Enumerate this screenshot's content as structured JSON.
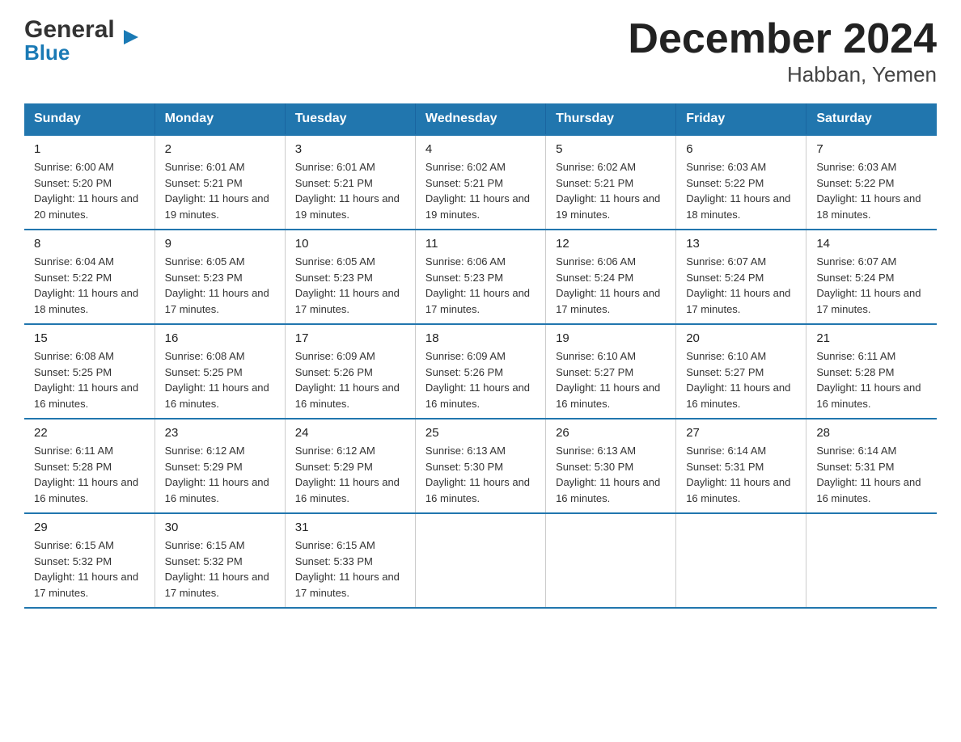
{
  "logo": {
    "general": "General",
    "blue": "Blue",
    "arrow": "▶"
  },
  "title": {
    "month_year": "December 2024",
    "location": "Habban, Yemen"
  },
  "headers": [
    "Sunday",
    "Monday",
    "Tuesday",
    "Wednesday",
    "Thursday",
    "Friday",
    "Saturday"
  ],
  "weeks": [
    [
      {
        "day": "1",
        "sunrise": "6:00 AM",
        "sunset": "5:20 PM",
        "daylight": "11 hours and 20 minutes."
      },
      {
        "day": "2",
        "sunrise": "6:01 AM",
        "sunset": "5:21 PM",
        "daylight": "11 hours and 19 minutes."
      },
      {
        "day": "3",
        "sunrise": "6:01 AM",
        "sunset": "5:21 PM",
        "daylight": "11 hours and 19 minutes."
      },
      {
        "day": "4",
        "sunrise": "6:02 AM",
        "sunset": "5:21 PM",
        "daylight": "11 hours and 19 minutes."
      },
      {
        "day": "5",
        "sunrise": "6:02 AM",
        "sunset": "5:21 PM",
        "daylight": "11 hours and 19 minutes."
      },
      {
        "day": "6",
        "sunrise": "6:03 AM",
        "sunset": "5:22 PM",
        "daylight": "11 hours and 18 minutes."
      },
      {
        "day": "7",
        "sunrise": "6:03 AM",
        "sunset": "5:22 PM",
        "daylight": "11 hours and 18 minutes."
      }
    ],
    [
      {
        "day": "8",
        "sunrise": "6:04 AM",
        "sunset": "5:22 PM",
        "daylight": "11 hours and 18 minutes."
      },
      {
        "day": "9",
        "sunrise": "6:05 AM",
        "sunset": "5:23 PM",
        "daylight": "11 hours and 17 minutes."
      },
      {
        "day": "10",
        "sunrise": "6:05 AM",
        "sunset": "5:23 PM",
        "daylight": "11 hours and 17 minutes."
      },
      {
        "day": "11",
        "sunrise": "6:06 AM",
        "sunset": "5:23 PM",
        "daylight": "11 hours and 17 minutes."
      },
      {
        "day": "12",
        "sunrise": "6:06 AM",
        "sunset": "5:24 PM",
        "daylight": "11 hours and 17 minutes."
      },
      {
        "day": "13",
        "sunrise": "6:07 AM",
        "sunset": "5:24 PM",
        "daylight": "11 hours and 17 minutes."
      },
      {
        "day": "14",
        "sunrise": "6:07 AM",
        "sunset": "5:24 PM",
        "daylight": "11 hours and 17 minutes."
      }
    ],
    [
      {
        "day": "15",
        "sunrise": "6:08 AM",
        "sunset": "5:25 PM",
        "daylight": "11 hours and 16 minutes."
      },
      {
        "day": "16",
        "sunrise": "6:08 AM",
        "sunset": "5:25 PM",
        "daylight": "11 hours and 16 minutes."
      },
      {
        "day": "17",
        "sunrise": "6:09 AM",
        "sunset": "5:26 PM",
        "daylight": "11 hours and 16 minutes."
      },
      {
        "day": "18",
        "sunrise": "6:09 AM",
        "sunset": "5:26 PM",
        "daylight": "11 hours and 16 minutes."
      },
      {
        "day": "19",
        "sunrise": "6:10 AM",
        "sunset": "5:27 PM",
        "daylight": "11 hours and 16 minutes."
      },
      {
        "day": "20",
        "sunrise": "6:10 AM",
        "sunset": "5:27 PM",
        "daylight": "11 hours and 16 minutes."
      },
      {
        "day": "21",
        "sunrise": "6:11 AM",
        "sunset": "5:28 PM",
        "daylight": "11 hours and 16 minutes."
      }
    ],
    [
      {
        "day": "22",
        "sunrise": "6:11 AM",
        "sunset": "5:28 PM",
        "daylight": "11 hours and 16 minutes."
      },
      {
        "day": "23",
        "sunrise": "6:12 AM",
        "sunset": "5:29 PM",
        "daylight": "11 hours and 16 minutes."
      },
      {
        "day": "24",
        "sunrise": "6:12 AM",
        "sunset": "5:29 PM",
        "daylight": "11 hours and 16 minutes."
      },
      {
        "day": "25",
        "sunrise": "6:13 AM",
        "sunset": "5:30 PM",
        "daylight": "11 hours and 16 minutes."
      },
      {
        "day": "26",
        "sunrise": "6:13 AM",
        "sunset": "5:30 PM",
        "daylight": "11 hours and 16 minutes."
      },
      {
        "day": "27",
        "sunrise": "6:14 AM",
        "sunset": "5:31 PM",
        "daylight": "11 hours and 16 minutes."
      },
      {
        "day": "28",
        "sunrise": "6:14 AM",
        "sunset": "5:31 PM",
        "daylight": "11 hours and 16 minutes."
      }
    ],
    [
      {
        "day": "29",
        "sunrise": "6:15 AM",
        "sunset": "5:32 PM",
        "daylight": "11 hours and 17 minutes."
      },
      {
        "day": "30",
        "sunrise": "6:15 AM",
        "sunset": "5:32 PM",
        "daylight": "11 hours and 17 minutes."
      },
      {
        "day": "31",
        "sunrise": "6:15 AM",
        "sunset": "5:33 PM",
        "daylight": "11 hours and 17 minutes."
      },
      null,
      null,
      null,
      null
    ]
  ],
  "labels": {
    "sunrise": "Sunrise:",
    "sunset": "Sunset:",
    "daylight": "Daylight:"
  }
}
